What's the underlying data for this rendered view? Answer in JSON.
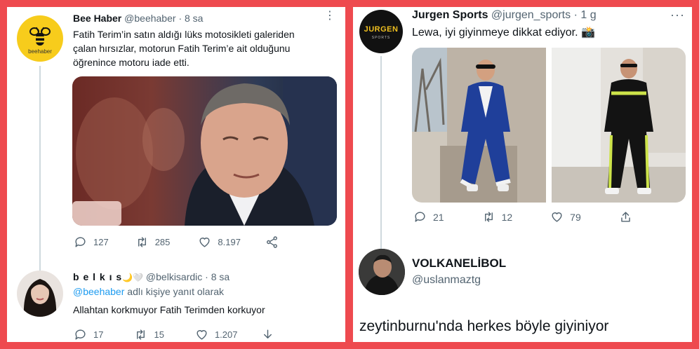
{
  "left": {
    "tweet1": {
      "author": "Bee Haber",
      "handle": "@beehaber",
      "sep": "·",
      "time": "8 sa",
      "avatar_caption": "beehaber",
      "lines": [
        "Fatih Terim’in satın aldığı lüks motosikleti galeriden",
        "çalan hırsızlar, motorun Fatih Terim’e ait olduğunu",
        "öğrenince motoru iade etti."
      ],
      "replies": "127",
      "retweets": "285",
      "likes": "8.197"
    },
    "tweet2": {
      "author": "b e l k ı s",
      "author_emoji": "🌙🤍",
      "handle": "@belkisardic",
      "sep": "·",
      "time": "8 sa",
      "reply_to": "@beehaber",
      "reply_suffix": "adlı kişiye yanıt olarak",
      "text": "Allahtan korkmuyor Fatih Terimden korkuyor",
      "replies": "17",
      "retweets": "15",
      "likes": "1.207"
    }
  },
  "right": {
    "tweet1": {
      "author": "Jurgen Sports",
      "handle": "@jurgen_sports",
      "sep": "·",
      "time": "1 g",
      "avatar_logo": "JURGEN",
      "avatar_logo_sub": "SPORTS",
      "text": "Lewa, iyi giyinmeye dikkat ediyor. 📸",
      "replies": "21",
      "retweets": "12",
      "likes": "79"
    },
    "tweet2": {
      "author": "VOLKANELİBOL",
      "handle": "@uslanmaztg",
      "text": "zeytinburnu'nda herkes böyle giyiniyor"
    }
  },
  "colors": {
    "frame": "#ee4a4f",
    "text": "#0f1419",
    "secondary": "#536471",
    "link": "#1d9bf0",
    "thread_line": "#cfd9de",
    "bee_yellow": "#f7cc1c"
  }
}
